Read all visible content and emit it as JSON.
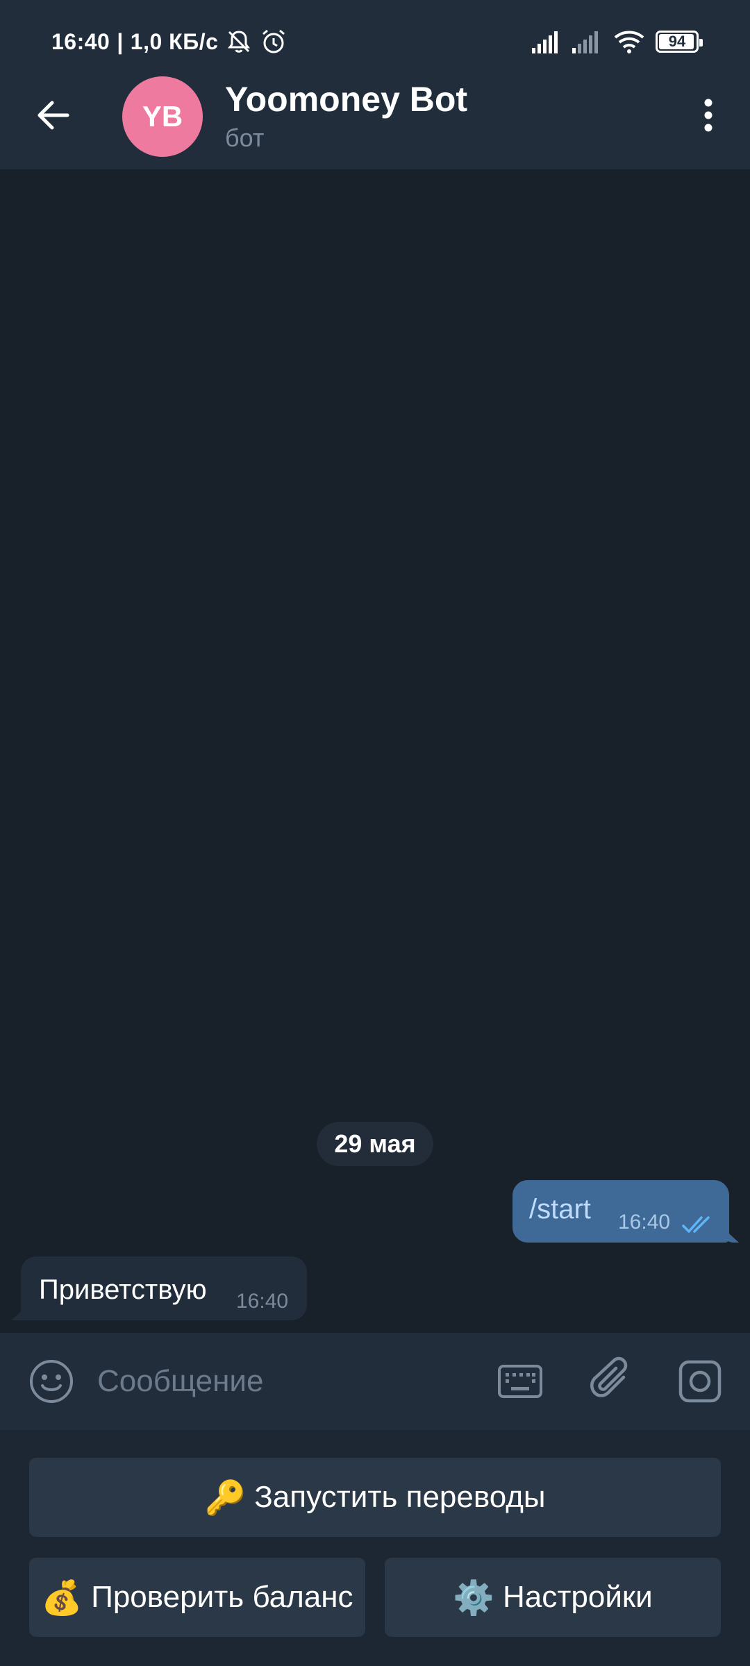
{
  "status_bar": {
    "time": "16:40",
    "separator": "|",
    "net_speed": "1,0 КБ/с",
    "battery": "94"
  },
  "header": {
    "avatar_initials": "YB",
    "title": "Yoomoney Bot",
    "subtitle": "бот",
    "avatar_color": "#ee7aa0"
  },
  "messages": {
    "date": "29 мая",
    "outgoing": {
      "text": "/start",
      "time": "16:40"
    },
    "incoming": {
      "text": "Приветствую",
      "time": "16:40"
    }
  },
  "input": {
    "placeholder": "Сообщение",
    "value": ""
  },
  "keyboard": {
    "row1": {
      "emoji": "🔑",
      "label": "Запустить переводы"
    },
    "row2_left": {
      "emoji": "💰",
      "label": "Проверить баланс"
    },
    "row2_right": {
      "emoji": "⚙️",
      "label": "Настройки"
    }
  },
  "colors": {
    "chat_bg": "#18202a",
    "bar_bg": "#212d3b",
    "outgoing_bubble": "#3f6a97",
    "accent": "#5eb5f7"
  }
}
